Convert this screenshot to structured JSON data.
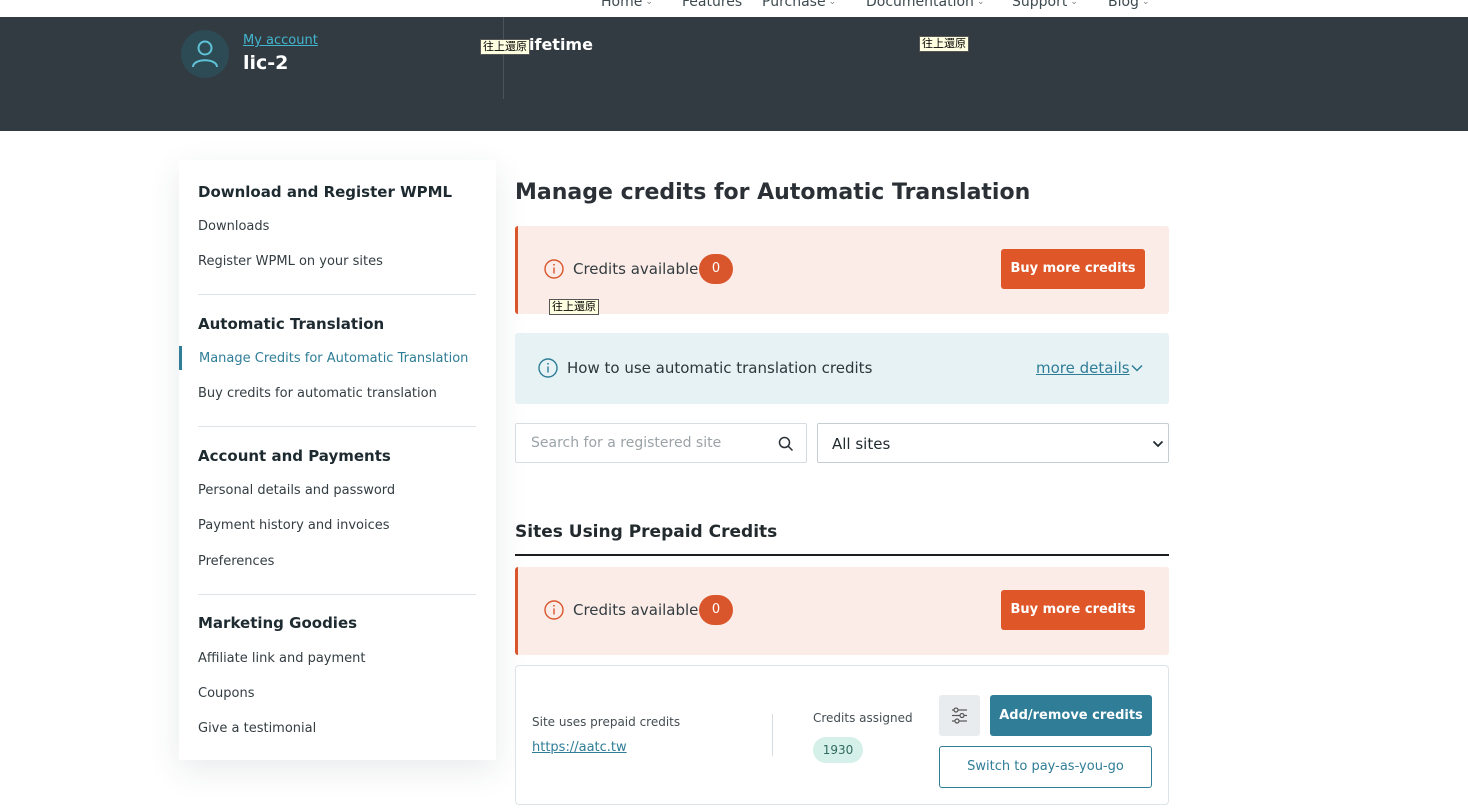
{
  "topnav": {
    "items": [
      {
        "label": "Home",
        "chevron": true
      },
      {
        "label": "Features",
        "chevron": false
      },
      {
        "label": "Purchase",
        "chevron": true
      },
      {
        "label": "Documentation",
        "chevron": true
      },
      {
        "label": "Support",
        "chevron": true
      },
      {
        "label": "Blog",
        "chevron": true
      }
    ]
  },
  "header": {
    "my_account": "My account",
    "license_name": "lic-2",
    "plan": "ifetime",
    "tooltip": "往上還原"
  },
  "sidebar": {
    "sections": [
      {
        "title": "Download and Register WPML",
        "links": [
          "Downloads",
          "Register WPML on your sites"
        ]
      },
      {
        "title": "Automatic Translation",
        "links": [
          "Manage Credits for Automatic Translation",
          "Buy credits for automatic translation"
        ]
      },
      {
        "title": "Account and Payments",
        "links": [
          "Personal details and password",
          "Payment history and invoices",
          "Preferences"
        ]
      },
      {
        "title": "Marketing Goodies",
        "links": [
          "Affiliate link and payment",
          "Coupons",
          "Give a testimonial"
        ]
      }
    ]
  },
  "main": {
    "title": "Manage credits for Automatic Translation",
    "credits_label": "Credits available",
    "credits_count": "0",
    "buy_label": "Buy more credits",
    "howto_label": "How to use automatic translation credits",
    "more_details": "more details",
    "search_placeholder": "Search for a registered site",
    "select_value": "All sites",
    "section_title": "Sites Using Prepaid Credits",
    "site": {
      "uses_label": "Site uses prepaid credits",
      "url": "https://aatc.tw",
      "assigned_label": "Credits assigned",
      "assigned_value": "1930",
      "add_remove": "Add/remove credits",
      "switch": "Switch to pay-as-you-go"
    }
  },
  "colors": {
    "header_bg": "#333b42",
    "accent": "#2f7d97",
    "warning": "#df5628",
    "warning_bg": "#fbece7",
    "info_bg": "#e7f2f5"
  },
  "icons": [
    "user-icon",
    "info-icon",
    "search-icon",
    "chevron-down-icon",
    "sliders-icon"
  ]
}
